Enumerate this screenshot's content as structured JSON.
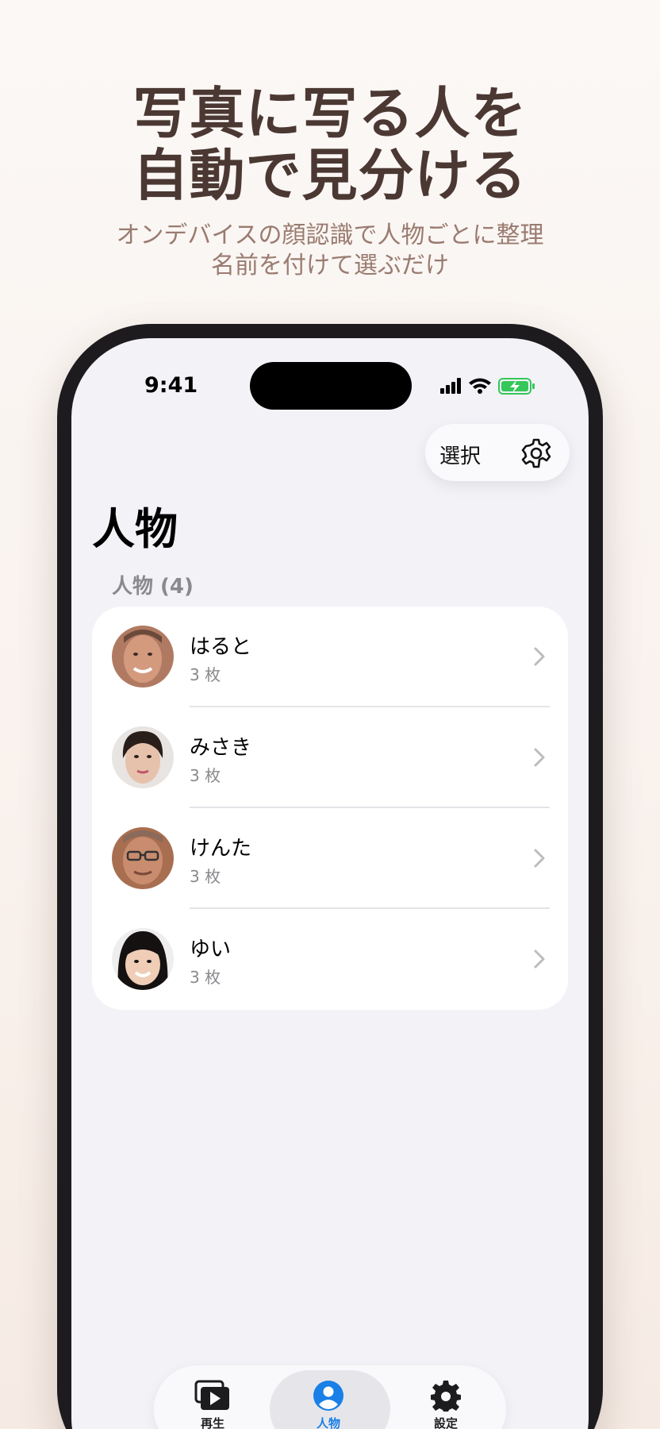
{
  "promo": {
    "headline_line1": "写真に写る人を",
    "headline_line2": "自動で見分ける",
    "subtitle_line1": "オンデバイスの顔認識で人物ごとに整理",
    "subtitle_line2": "名前を付けて選ぶだけ"
  },
  "status_bar": {
    "time": "9:41"
  },
  "toolbar": {
    "select_label": "選択",
    "settings_icon": "gear-icon"
  },
  "nav": {
    "title": "人物"
  },
  "section": {
    "header": "人物 (4)"
  },
  "people": [
    {
      "name": "はると",
      "count": "3 枚"
    },
    {
      "name": "みさき",
      "count": "3 枚"
    },
    {
      "name": "けんた",
      "count": "3 枚"
    },
    {
      "name": "ゆい",
      "count": "3 枚"
    }
  ],
  "tabs": [
    {
      "label": "再生",
      "icon": "play-photos-icon"
    },
    {
      "label": "人物",
      "icon": "person-icon"
    },
    {
      "label": "設定",
      "icon": "gear-icon"
    }
  ],
  "colors": {
    "accent": "#1a7fe6",
    "headline": "#4b3833",
    "subtitle": "#9a7b70",
    "battery": "#34c759"
  }
}
